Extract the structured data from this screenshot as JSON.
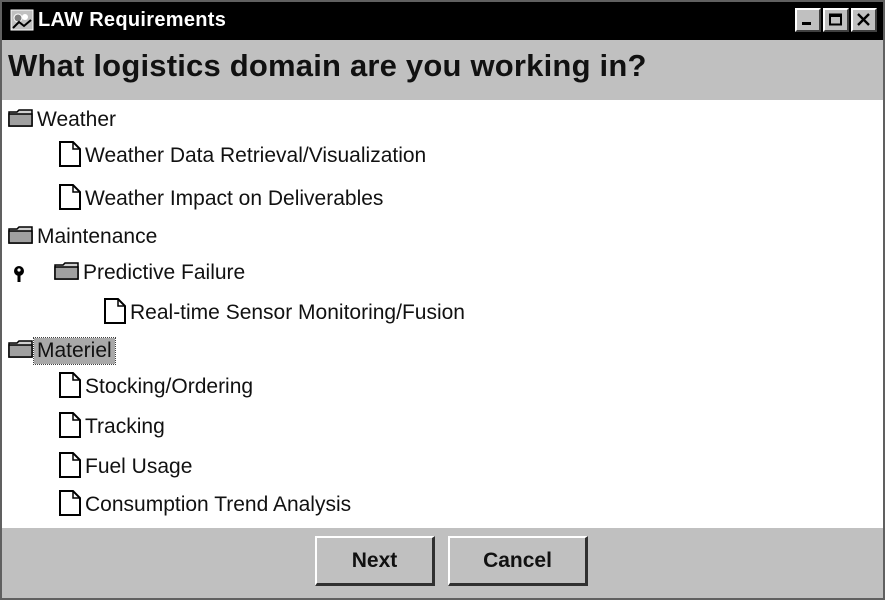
{
  "window": {
    "title": "LAW Requirements",
    "controls": [
      "minimize-icon",
      "maximize-icon",
      "close-icon"
    ]
  },
  "heading": {
    "question": "What logistics domain are you working in?"
  },
  "tree": {
    "weather": {
      "label": "Weather",
      "children": {
        "data_retrieval": "Weather Data Retrieval/Visualization",
        "impact": "Weather Impact on Deliverables"
      }
    },
    "maintenance": {
      "label": "Maintenance",
      "predictive_failure": {
        "label": "Predictive Failure",
        "children": {
          "sensor_monitoring": "Real-time Sensor Monitoring/Fusion"
        }
      }
    },
    "materiel": {
      "label": "Materiel",
      "selected": true,
      "children": {
        "stocking": "Stocking/Ordering",
        "tracking": "Tracking",
        "fuel": "Fuel Usage",
        "consumption": "Consumption Trend Analysis"
      }
    }
  },
  "buttons": {
    "next": "Next",
    "cancel": "Cancel"
  },
  "colors": {
    "titlebar": "#000000",
    "panel": "#c0c0c0",
    "tree_background": "#ffffff",
    "selection": "#a9a9a9"
  }
}
